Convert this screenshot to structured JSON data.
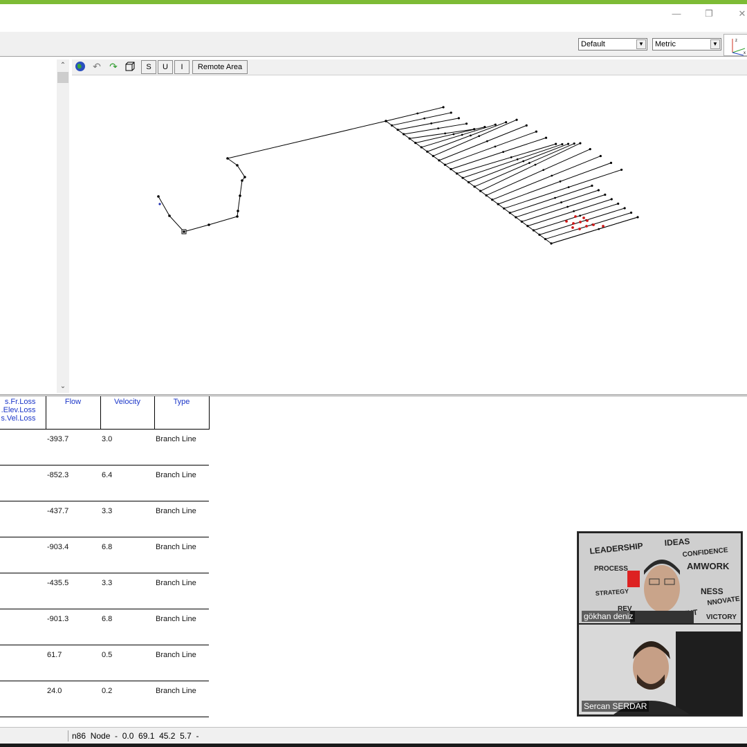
{
  "window": {
    "accent_color": "#7dbb35",
    "minimize_icon": "minimize-icon",
    "restore_icon": "restore-icon",
    "close_icon": "close-icon"
  },
  "toolbar": {
    "view_select": "Default",
    "units_select": "Metric"
  },
  "view_toolbar": {
    "globe_icon": "globe-icon",
    "undo_icon": "undo-icon",
    "redo_icon": "redo-icon",
    "box3d_icon": "box-3d-icon",
    "btn_s": "S",
    "btn_u": "U",
    "btn_i": "I",
    "remote_area": "Remote Area"
  },
  "table": {
    "columns": {
      "loss": [
        "s.Fr.Loss",
        ".Elev.Loss",
        "s.Vel.Loss"
      ],
      "flow": "Flow",
      "velocity": "Velocity",
      "type": "Type"
    },
    "rows": [
      {
        "flow": "-393.7",
        "velocity": "3.0",
        "type": "Branch Line"
      },
      {
        "flow": "-852.3",
        "velocity": "6.4",
        "type": "Branch Line"
      },
      {
        "flow": "-437.7",
        "velocity": "3.3",
        "type": "Branch Line"
      },
      {
        "flow": "-903.4",
        "velocity": "6.8",
        "type": "Branch Line"
      },
      {
        "flow": "-435.5",
        "velocity": "3.3",
        "type": "Branch Line"
      },
      {
        "flow": "-901.3",
        "velocity": "6.8",
        "type": "Branch Line"
      },
      {
        "flow": "61.7",
        "velocity": "0.5",
        "type": "Branch Line"
      },
      {
        "flow": "24.0",
        "velocity": "0.2",
        "type": "Branch Line"
      }
    ]
  },
  "status": {
    "text": "n86  Node  -  0.0  69.1  45.2  5.7  -"
  },
  "video": {
    "participant_1": "gökhan deniz",
    "participant_2": "Sercan SERDAR",
    "wall_words": [
      "LEADERSHIP",
      "IDEAS",
      "CONFIDENCE",
      "PROCESS",
      "AMWORK",
      "STRATEGY",
      "NESS",
      "NNOVATE",
      "REV",
      "ENT",
      "VICTORY"
    ]
  }
}
